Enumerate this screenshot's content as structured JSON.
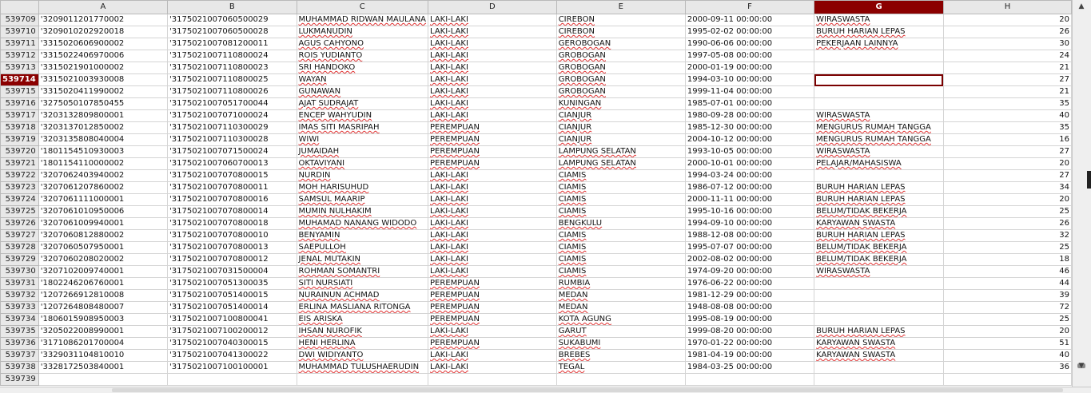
{
  "columns": [
    "A",
    "B",
    "C",
    "D",
    "E",
    "F",
    "G",
    "H"
  ],
  "selected_column": "G",
  "selected_row": "539714",
  "rows": [
    {
      "n": "539709",
      "a": "'3209011201770002",
      "b": "'3175021007060500029",
      "c": "MUHAMMAD RIDWAN MAULANA",
      "d": "LAKI-LAKI",
      "e": "CIREBON",
      "f": "2000-09-11 00:00:00",
      "g": "WIRASWASTA",
      "h": "20"
    },
    {
      "n": "539710",
      "a": "'3209010202920018",
      "b": "'3175021007060500028",
      "c": "LUKMANUDIN",
      "d": "LAKI-LAKI",
      "e": "CIREBON",
      "f": "1995-02-02 00:00:00",
      "g": "BURUH HARIAN LEPAS",
      "h": "26"
    },
    {
      "n": "539711",
      "a": "'3315020606900002",
      "b": "'3175021007081200011",
      "c": "AGUS CAHYONO",
      "d": "LAKI-LAKI",
      "e": "GEROBOGAN",
      "f": "1990-06-06 00:00:00",
      "g": "PEKERJAAN LAINNYA",
      "h": "30"
    },
    {
      "n": "539712",
      "a": "'3315022406970006",
      "b": "'3175021007110800024",
      "c": "ROIS YUDIANTO",
      "d": "LAKI-LAKI",
      "e": "GROBOGAN",
      "f": "1997-05-08 00:00:00",
      "g": "",
      "h": "24"
    },
    {
      "n": "539713",
      "a": "'3315021901000002",
      "b": "'3175021007110800023",
      "c": "SRI HANDOKO",
      "d": "LAKI-LAKI",
      "e": "GROBOGAN",
      "f": "2000-01-19 00:00:00",
      "g": "",
      "h": "21"
    },
    {
      "n": "539714",
      "a": "'3315021003930008",
      "b": "'3175021007110800025",
      "c": "WAYAN",
      "d": "LAKI-LAKI",
      "e": "GROBOGAN",
      "f": "1994-03-10 00:00:00",
      "g": "",
      "h": "27"
    },
    {
      "n": "539715",
      "a": "'3315020411990002",
      "b": "'3175021007110800026",
      "c": "GUNAWAN",
      "d": "LAKI-LAKI",
      "e": "GROBOGAN",
      "f": "1999-11-04 00:00:00",
      "g": "",
      "h": "21"
    },
    {
      "n": "539716",
      "a": "'3275050107850455",
      "b": "'3175021007051700044",
      "c": "AJAT SUDRAJAT",
      "d": "LAKI-LAKI",
      "e": "KUNINGAN",
      "f": "1985-07-01 00:00:00",
      "g": "",
      "h": "35"
    },
    {
      "n": "539717",
      "a": "'3203132809800001",
      "b": "'3175021007071000024",
      "c": "ENCEP WAHYUDIN",
      "d": "LAKI-LAKI",
      "e": "CIANJUR",
      "f": "1980-09-28 00:00:00",
      "g": "WIRASWASTA",
      "h": "40"
    },
    {
      "n": "539718",
      "a": "'3203137012850002",
      "b": "'3175021007110300029",
      "c": "IMAS SITI MASRIPAH",
      "d": "PEREMPUAN",
      "e": "CIANJUR",
      "f": "1985-12-30 00:00:00",
      "g": "MENGURUS RUMAH TANGGA",
      "h": "35"
    },
    {
      "n": "539719",
      "a": "'3203135808040004",
      "b": "'3175021007110300028",
      "c": "WIWI",
      "d": "PEREMPUAN",
      "e": "CIANJUR",
      "f": "2004-10-12 00:00:00",
      "g": "MENGURUS RUMAH TANGGA",
      "h": "16"
    },
    {
      "n": "539720",
      "a": "'1801154510930003",
      "b": "'3175021007071500024",
      "c": "JUMAIDAH",
      "d": "PEREMPUAN",
      "e": "LAMPUNG SELATAN",
      "f": "1993-10-05 00:00:00",
      "g": "WIRASWASTA",
      "h": "27"
    },
    {
      "n": "539721",
      "a": "'1801154110000002",
      "b": "'3175021007060700013",
      "c": "OKTAVIYANI",
      "d": "PEREMPUAN",
      "e": "LAMPUNG SELATAN",
      "f": "2000-10-01 00:00:00",
      "g": "PELAJAR/MAHASISWA",
      "h": "20"
    },
    {
      "n": "539722",
      "a": "'3207062403940002",
      "b": "'3175021007070800015",
      "c": "NURDIN",
      "d": "LAKI-LAKI",
      "e": "CIAMIS",
      "f": "1994-03-24 00:00:00",
      "g": "",
      "h": "27"
    },
    {
      "n": "539723",
      "a": "'3207061207860002",
      "b": "'3175021007070800011",
      "c": "MOH HARISUHUD",
      "d": "LAKI-LAKI",
      "e": "CIAMIS",
      "f": "1986-07-12 00:00:00",
      "g": "BURUH HARIAN LEPAS",
      "h": "34"
    },
    {
      "n": "539724",
      "a": "'3207061111000001",
      "b": "'3175021007070800016",
      "c": "SAMSUL MAARIP",
      "d": "LAKI-LAKI",
      "e": "CIAMIS",
      "f": "2000-11-11 00:00:00",
      "g": "BURUH HARIAN LEPAS",
      "h": "20"
    },
    {
      "n": "539725",
      "a": "'3207061010950006",
      "b": "'3175021007070800014",
      "c": "MUMIN NULHAKIM",
      "d": "LAKI-LAKI",
      "e": "CIAMIS",
      "f": "1995-10-16 00:00:00",
      "g": "BELUM/TIDAK BEKERJA",
      "h": "25"
    },
    {
      "n": "539726",
      "a": "'3207061009940001",
      "b": "'3175021007070800018",
      "c": "MUHAMAD NANANG WIDODO",
      "d": "LAKI-LAKI",
      "e": "BENGKULU",
      "f": "1994-09-10 00:00:00",
      "g": "KARYAWAN SWASTA",
      "h": "26"
    },
    {
      "n": "539727",
      "a": "'3207060812880002",
      "b": "'3175021007070800010",
      "c": "BENYAMIN",
      "d": "LAKI-LAKI",
      "e": "CIAMIS",
      "f": "1988-12-08 00:00:00",
      "g": "BURUH HARIAN LEPAS",
      "h": "32"
    },
    {
      "n": "539728",
      "a": "'3207060507950001",
      "b": "'3175021007070800013",
      "c": "SAEPULLOH",
      "d": "LAKI-LAKI",
      "e": "CIAMIS",
      "f": "1995-07-07 00:00:00",
      "g": "BELUM/TIDAK BEKERJA",
      "h": "25"
    },
    {
      "n": "539729",
      "a": "'3207060208020002",
      "b": "'3175021007070800012",
      "c": "JENAL MUTAKIN",
      "d": "LAKI-LAKI",
      "e": "CIAMIS",
      "f": "2002-08-02 00:00:00",
      "g": "BELUM/TIDAK BEKERJA",
      "h": "18"
    },
    {
      "n": "539730",
      "a": "'3207102009740001",
      "b": "'3175021007031500004",
      "c": "ROHMAN SOMANTRI",
      "d": "LAKI-LAKI",
      "e": "CIAMIS",
      "f": "1974-09-20 00:00:00",
      "g": "WIRASWASTA",
      "h": "46"
    },
    {
      "n": "539731",
      "a": "'1802246206760001",
      "b": "'3175021007051300035",
      "c": "SITI NURSIATI",
      "d": "PEREMPUAN",
      "e": "RUMBIA",
      "f": "1976-06-22 00:00:00",
      "g": "",
      "h": "44"
    },
    {
      "n": "539732",
      "a": "'1207266912810008",
      "b": "'3175021007051400015",
      "c": "NURAINUN ACHMAD",
      "d": "PEREMPUAN",
      "e": "MEDAN",
      "f": "1981-12-29 00:00:00",
      "g": "",
      "h": "39"
    },
    {
      "n": "539733",
      "a": "'1207264808480007",
      "b": "'3175021007051400014",
      "c": "ERLINA MASLIANA RITONGA",
      "d": "PEREMPUAN",
      "e": "MEDAN",
      "f": "1948-08-08 00:00:00",
      "g": "",
      "h": "72"
    },
    {
      "n": "539734",
      "a": "'1806015908950003",
      "b": "'3175021007100800041",
      "c": "EIS ARISKA",
      "d": "PEREMPUAN",
      "e": "KOTA AGUNG",
      "f": "1995-08-19 00:00:00",
      "g": "",
      "h": "25"
    },
    {
      "n": "539735",
      "a": "'3205022008990001",
      "b": "'3175021007100200012",
      "c": "IHSAN NUROFIK",
      "d": "LAKI-LAKI",
      "e": "GARUT",
      "f": "1999-08-20 00:00:00",
      "g": "BURUH HARIAN LEPAS",
      "h": "20"
    },
    {
      "n": "539736",
      "a": "'3171086201700004",
      "b": "'3175021007040300015",
      "c": "HENI HERLINA",
      "d": "PEREMPUAN",
      "e": "SUKABUMI",
      "f": "1970-01-22 00:00:00",
      "g": "KARYAWAN SWASTA",
      "h": "51"
    },
    {
      "n": "539737",
      "a": "'3329031104810010",
      "b": "'3175021007041300022",
      "c": "DWI WIDIYANTO",
      "d": "LAKI-LAKI",
      "e": "BREBES",
      "f": "1981-04-19 00:00:00",
      "g": "KARYAWAN SWASTA",
      "h": "40"
    },
    {
      "n": "539738",
      "a": "'3328172503840001",
      "b": "'3175021007100100001",
      "c": "MUHAMMAD TULUSHAERUDIN",
      "d": "LAKI-LAKI",
      "e": "TEGAL",
      "f": "1984-03-25 00:00:00",
      "g": "",
      "h": "36"
    },
    {
      "n": "539739",
      "a": "",
      "b": "",
      "c": "",
      "d": "",
      "e": "",
      "f": "",
      "g": "",
      "h": ""
    }
  ]
}
